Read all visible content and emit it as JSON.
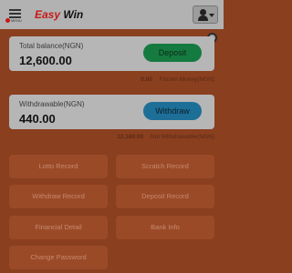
{
  "header": {
    "menu_label": "MENU",
    "logo_part1": "Easy",
    "logo_part2": "Win"
  },
  "balance": {
    "label": "Total balance(NGN)",
    "amount": "12,600.00",
    "button": "Deposit",
    "frozen_value": "0.00",
    "frozen_label": "Frozen Money(NGN)"
  },
  "withdrawable": {
    "label": "Withdrawable(NGN)",
    "amount": "440.00",
    "button": "Withdraw",
    "not_value": "12,160.00",
    "not_label": "Not Withdrawable(NGN)"
  },
  "menu_grid": [
    "Lotto Record",
    "Scratch Record",
    "Withdraw Record",
    "Deposit Record",
    "Financial Detail",
    "Bank Info",
    "Change Password"
  ],
  "colors": {
    "background": "#8a3f1f",
    "deposit": "#157a3f",
    "withdraw": "#1d6f98"
  }
}
